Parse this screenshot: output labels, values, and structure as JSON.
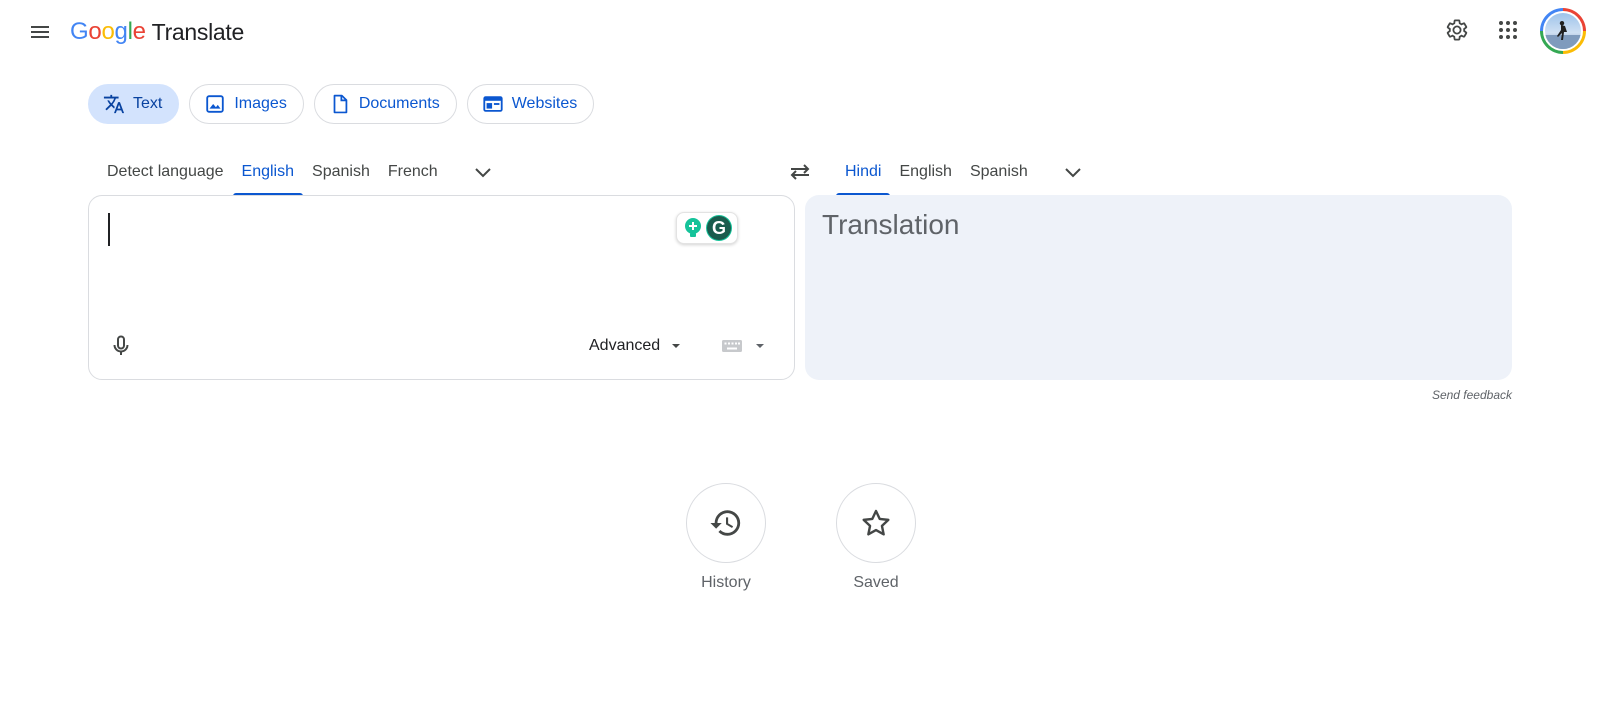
{
  "header": {
    "logo_letters": [
      "G",
      "o",
      "o",
      "g",
      "l",
      "e"
    ],
    "product_name": "Translate",
    "icons": [
      "menu-icon",
      "settings-gear-icon",
      "apps-grid-icon",
      "account-avatar"
    ]
  },
  "modes": [
    {
      "label": "Text",
      "icon": "translate-icon",
      "active": true
    },
    {
      "label": "Images",
      "icon": "image-icon",
      "active": false
    },
    {
      "label": "Documents",
      "icon": "document-icon",
      "active": false
    },
    {
      "label": "Websites",
      "icon": "website-icon",
      "active": false
    }
  ],
  "source_languages": [
    {
      "label": "Detect language",
      "active": false
    },
    {
      "label": "English",
      "active": true
    },
    {
      "label": "Spanish",
      "active": false
    },
    {
      "label": "French",
      "active": false
    }
  ],
  "target_languages": [
    {
      "label": "Hindi",
      "active": true
    },
    {
      "label": "English",
      "active": false
    },
    {
      "label": "Spanish",
      "active": false
    }
  ],
  "source": {
    "text": "",
    "advanced_label": "Advanced"
  },
  "target": {
    "placeholder": "Translation"
  },
  "feedback_label": "Send feedback",
  "quick_actions": {
    "history_label": "History",
    "saved_label": "Saved"
  },
  "colors": {
    "accent": "#0b57d0",
    "active_chip_bg": "#d3e3fd",
    "target_panel_bg": "#eef2f9",
    "grammarly_green": "#15c39a"
  }
}
